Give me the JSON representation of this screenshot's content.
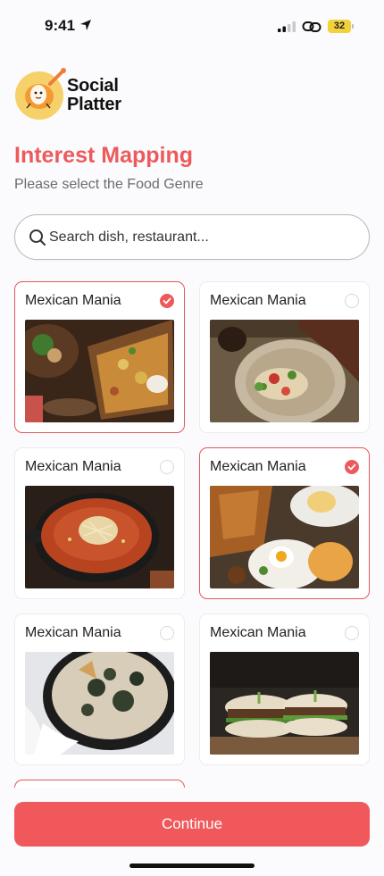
{
  "status_bar": {
    "time": "9:41",
    "battery": "32"
  },
  "brand": {
    "line1": "Social",
    "line2": "Platter"
  },
  "header": {
    "title": "Interest Mapping",
    "subtitle": "Please select the Food Genre"
  },
  "search": {
    "placeholder": "Search dish, restaurant..."
  },
  "cards": [
    {
      "title": "Mexican Mania",
      "selected": true,
      "image": "nachos-platter"
    },
    {
      "title": "Mexican Mania",
      "selected": false,
      "image": "tacos-plate"
    },
    {
      "title": "Mexican Mania",
      "selected": false,
      "image": "soup-pot"
    },
    {
      "title": "Mexican Mania",
      "selected": true,
      "image": "breakfast-spread"
    },
    {
      "title": "Mexican Mania",
      "selected": false,
      "image": "spinach-skillet"
    },
    {
      "title": "Mexican Mania",
      "selected": false,
      "image": "burger-sliders"
    }
  ],
  "footer": {
    "continue_label": "Continue"
  },
  "colors": {
    "accent": "#ec5a5c",
    "battery": "#f3d13b"
  }
}
